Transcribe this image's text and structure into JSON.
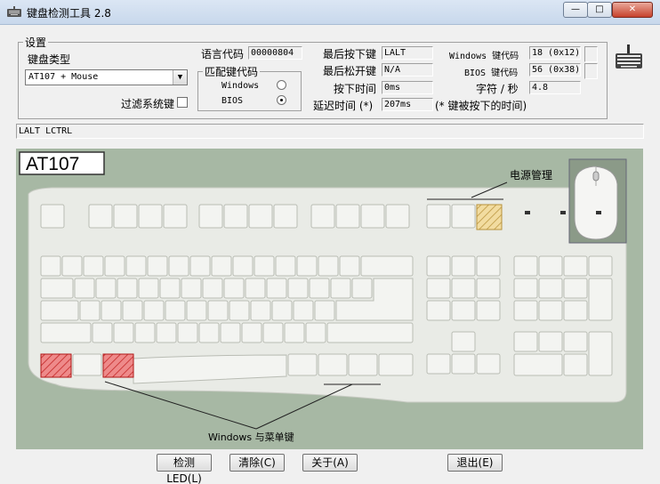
{
  "window": {
    "title": "键盘检测工具 2.8",
    "min": "—",
    "max": "□",
    "close": "✕"
  },
  "settings": {
    "legend": "设置",
    "keyboard_type_label": "键盘类型",
    "keyboard_type_value": "AT107 + Mouse",
    "filter_label": "过滤系统键",
    "filter_checked": false,
    "lang_code_label": "语言代码",
    "lang_code_value": "00000804",
    "match_legend": "匹配键代码",
    "match_windows": "Windows",
    "match_bios": "BIOS",
    "match_selected": "BIOS"
  },
  "stats": {
    "last_down_label": "最后按下键",
    "last_down_value": "LALT",
    "last_up_label": "最后松开键",
    "last_up_value": "N/A",
    "down_time_label": "按下时间",
    "down_time_value": "0ms",
    "delay_label": "延迟时间 (*)",
    "delay_value": "207ms",
    "delay_note": "(* 键被按下的时间)",
    "win_code_label": "Windows 键代码",
    "win_code_value": "18 (0x12)",
    "bios_code_label": "BIOS 键代码",
    "bios_code_value": "56 (0x38)",
    "rate_label": "字符 / 秒",
    "rate_value": "4.8"
  },
  "status_text": "LALT LCTRL",
  "keyboard": {
    "model_label": "AT107",
    "power_label": "电源管理",
    "windows_menu_label": "Windows 与菜单键",
    "colors": {
      "panel": "#a7b8a4",
      "body": "#e9ebe6",
      "key": "#f3f4f1",
      "pressed": "#e24848",
      "power_key": "#e8c985"
    }
  },
  "buttons": {
    "led": "检测LED(L)",
    "clear": "清除(C)",
    "about": "关于(A)",
    "exit": "退出(E)"
  }
}
